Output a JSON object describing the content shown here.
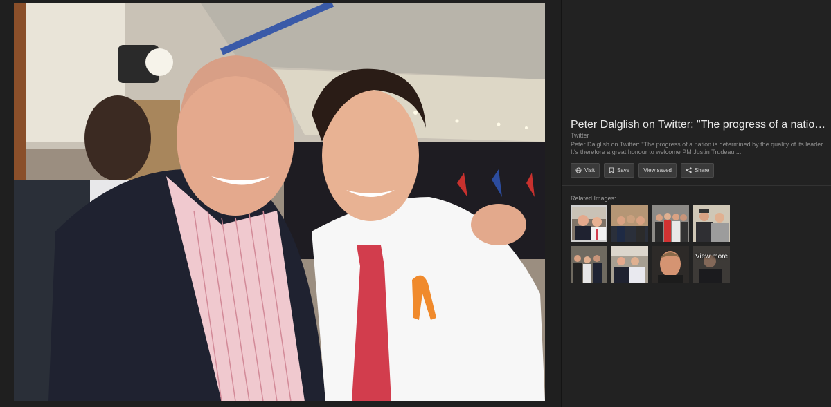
{
  "details": {
    "title": "Peter Dalglish on Twitter: \"The progress of a nation is de…",
    "source": "Twitter",
    "description": "Peter Dalglish on Twitter: \"The progress of a nation is determined by the quality of its leader. It's therefore a great honour to welcome PM Justin Trudeau ..."
  },
  "actions": [
    {
      "label": "Visit",
      "icon": "globe-icon"
    },
    {
      "label": "Save",
      "icon": "bookmark-icon"
    },
    {
      "label": "View saved",
      "icon": ""
    },
    {
      "label": "Share",
      "icon": "share-icon"
    }
  ],
  "related": {
    "label": "Related Images:",
    "view_more": "View more"
  }
}
